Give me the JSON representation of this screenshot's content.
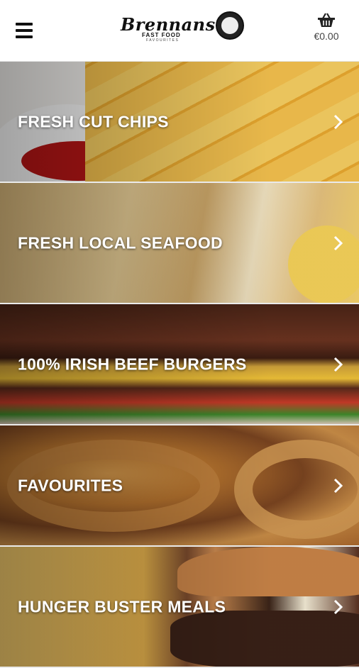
{
  "header": {
    "logo": {
      "wordmark": "Brennans",
      "tagline": "FAST FOOD",
      "subtagline": "FAVOURITES"
    },
    "cart_total": "€0.00"
  },
  "categories": [
    {
      "label": "FRESH CUT CHIPS"
    },
    {
      "label": "FRESH LOCAL SEAFOOD"
    },
    {
      "label": "100% IRISH BEEF BURGERS"
    },
    {
      "label": "FAVOURITES"
    },
    {
      "label": "HUNGER BUSTER MEALS"
    }
  ],
  "icons": {
    "menu": "hamburger-menu-icon",
    "cart": "shopping-basket-icon",
    "chevron": "chevron-right-icon"
  },
  "colors": {
    "header_bg": "#ffffff",
    "label_text": "#ffffff"
  }
}
